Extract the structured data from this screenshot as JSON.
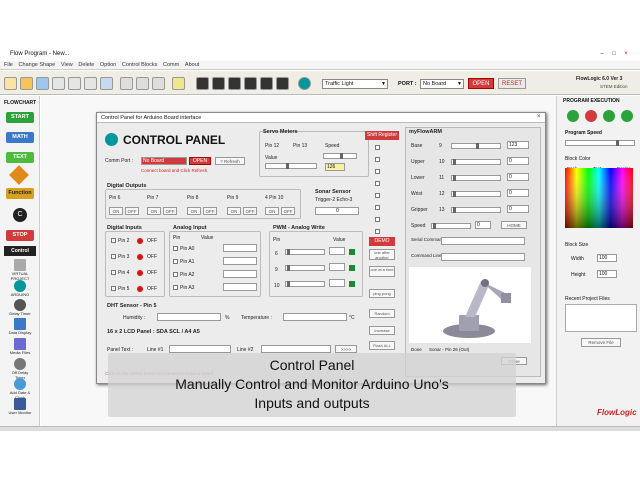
{
  "window": {
    "title": "Flow Program - New...",
    "min": "–",
    "max": "□",
    "close": "×"
  },
  "menu": [
    "File",
    "Change Shape",
    "View",
    "Delete",
    "Option",
    "Control Blocks",
    "Comm",
    "About"
  ],
  "toolbar": {
    "program_select": "Traffic Light",
    "port_label": "PORT :",
    "board_select": "No Board",
    "open_label": "OPEN",
    "reset_label": "RESET",
    "brand": "FlowLogic 6.0 Ver 3",
    "brand_sub": "STEM Edition"
  },
  "left": {
    "header": "FLOWCHART",
    "start": "START",
    "math": "MATH",
    "text": "TEXT",
    "function": "Function",
    "stop": "STOP",
    "items": [
      "Control",
      "VIRTUAL PROJECT",
      "ARDUINO",
      "Delay Timer",
      "Data Display",
      "Media Files",
      "Off Delay Timer",
      "Add Date & Clock",
      "User Monitor"
    ]
  },
  "cp": {
    "header": "Control Panel  for Arduino Board interface",
    "title": "CONTROL PANEL",
    "comm_port": "Comm Port :",
    "no_board": "No Board",
    "open": "OPEN",
    "refresh": "? Refresh",
    "connect_msg": "Connect board and Click Refresh.",
    "servo_title": "Servo Meters",
    "pin12": "Pin 12",
    "pin13": "Pin 13",
    "speed": "Speed",
    "value": "Value",
    "speed_value": "126",
    "shift_register": "Shift Register",
    "digital_outputs": "Digital Outputs",
    "pins_out": [
      "Pin 6",
      "Pin 7",
      "Pin 8",
      "Pin 9",
      "4 Pin 10"
    ],
    "on": "ON",
    "off": "OFF",
    "sonar": "Sonar Sensor",
    "trigger": "Trigger-2 Echo-3",
    "sonar_val": "0",
    "digital_inputs": "Digital Inputs",
    "pins_in": [
      "Pin 2",
      "Pin 3",
      "Pin 4",
      "Pin 5"
    ],
    "analog_input": "Analog Input",
    "pin_col": "Pin",
    "value_col": "Value",
    "analog_pins": [
      "Pin A0",
      "Pin A1",
      "Pin A2",
      "Pin A3"
    ],
    "pwm_title": "PWM - Analog Write",
    "pwm_pins": [
      "6",
      "9",
      "10"
    ],
    "dht": "DHT Sensor - Pin 5",
    "humidity": "Humidity :",
    "temperature": "Temperature :",
    "pct": "%",
    "deg": "°C",
    "lcd": "16 x 2 LCD Panel : SDA SCL / A4 A5",
    "panel_text": "Panel Text :",
    "line1": "Line #1",
    "line2": "Line #2",
    "send_arrows": ">>>>",
    "bottom_msg": "Click on the OPEN Button to connect to Arduino board.",
    "side_buttons": [
      "DEMO",
      "one after another",
      "one at a time",
      "ping pong",
      "Random",
      "Increase",
      "Flash ALL"
    ],
    "arm_title": "myFlowARM",
    "arm_rows": [
      {
        "label": "Base",
        "num": "9",
        "val": "123"
      },
      {
        "label": "Upper",
        "num": "10",
        "val": "0"
      },
      {
        "label": "Lower",
        "num": "11",
        "val": "0"
      },
      {
        "label": "Wrist",
        "num": "12",
        "val": "0"
      },
      {
        "label": "Gripper",
        "num": "13",
        "val": "0"
      }
    ],
    "arm_speed": "Speed",
    "arm_speed_val": "0",
    "home": "HOME",
    "serial_command": "Serial Command",
    "command_line": "Command Line",
    "done": "Done",
    "sonar_pin": "Sonar - Pin 26 (Out)",
    "close_btn": "Close"
  },
  "right": {
    "program_execution": "PROGRAM EXECUTION",
    "program_speed": "Program Speed",
    "block_color": "Block Color",
    "back": "Back",
    "text": "Text",
    "border": "Border",
    "block_size": "Block Size",
    "width": "Width",
    "width_val": "100",
    "height": "Height",
    "height_val": "100",
    "recent_files": "Recent Project Files",
    "remove_file": "Remove File",
    "logo": "FlowLogic"
  },
  "overlay": {
    "line1": "Control Panel",
    "line2": "Manually Control and Monitor Arduino Uno's",
    "line3": "Inputs and outputs"
  },
  "colors": {
    "accent_red": "#d23b3b",
    "green": "#2aa33a",
    "blue": "#3a78c8",
    "orange": "#e08a1a"
  }
}
